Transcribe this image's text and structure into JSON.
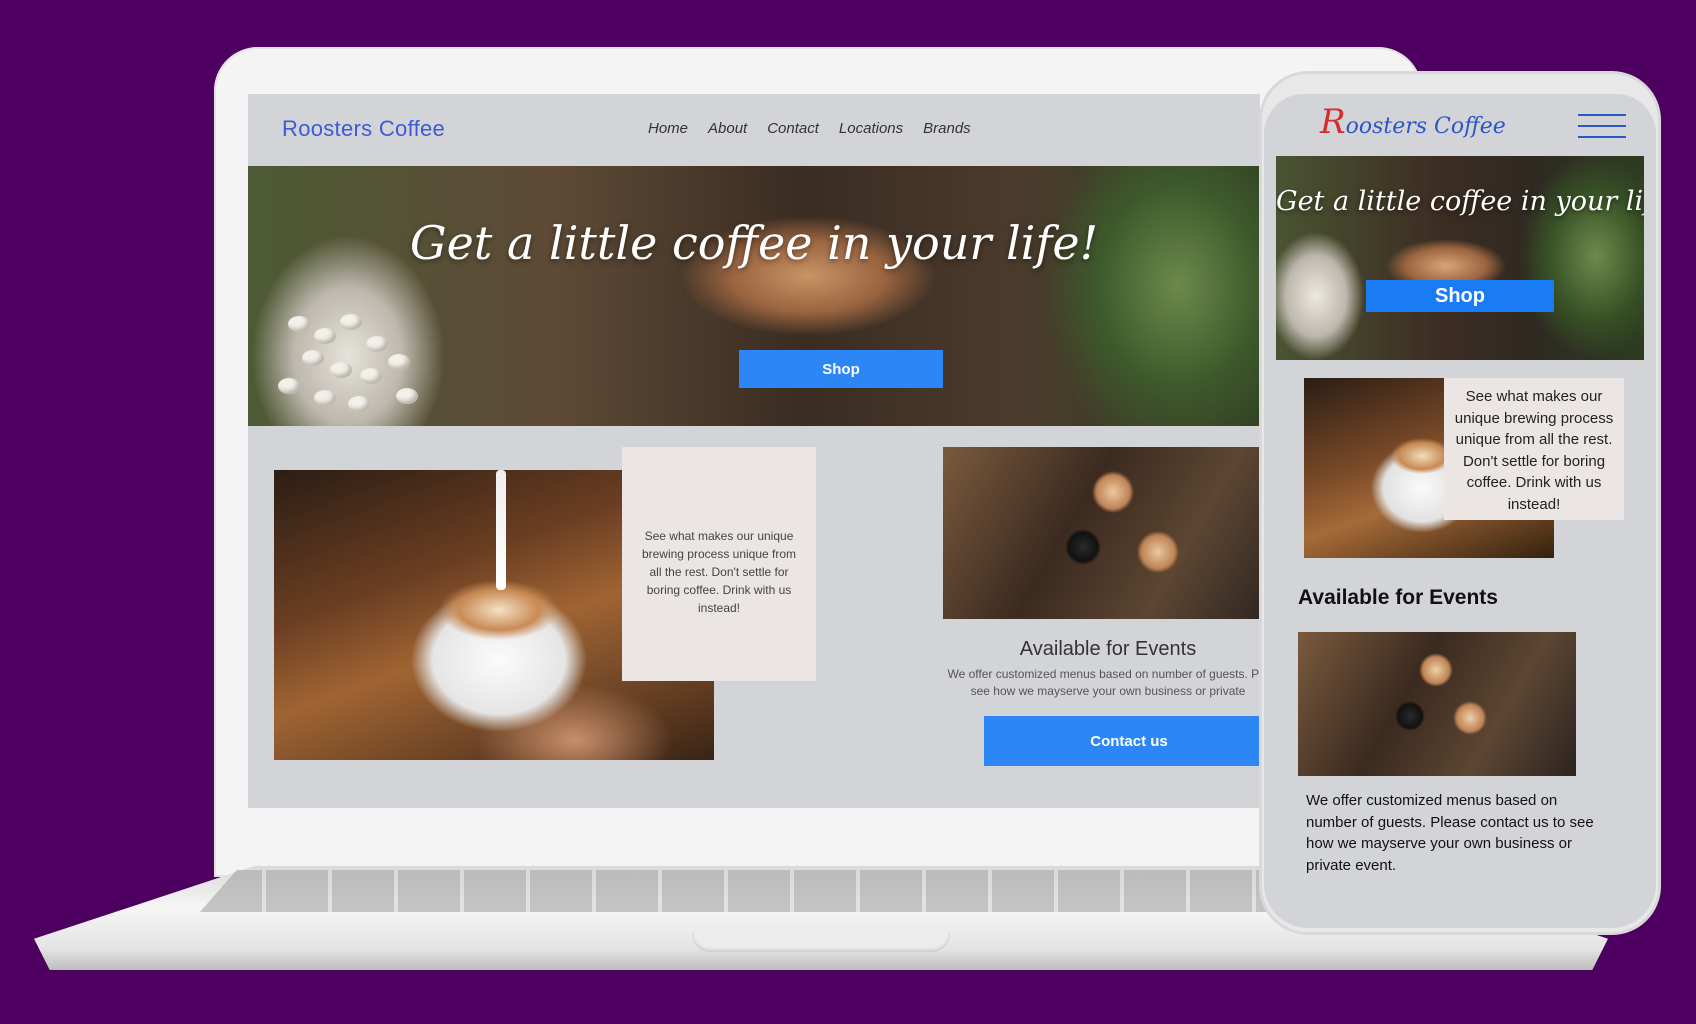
{
  "desktop": {
    "logo": "Roosters Coffee",
    "nav": [
      "Home",
      "About",
      "Contact",
      "Locations",
      "Brands"
    ],
    "hero_title": "Get a little coffee in your life!",
    "shop_label": "Shop",
    "brew_text": "See what makes our unique brewing process unique from all the rest. Don't settle for boring coffee. Drink with us instead!",
    "events_title": "Available for Events",
    "events_text_line1": "We offer customized menus based on number of guests. Ple",
    "events_text_line2": "see how we mayserve your own business or private",
    "contact_label": "Contact us"
  },
  "mobile": {
    "logo_initial": "R",
    "logo_rest": "oosters Coffee",
    "hero_title": "Get a little coffee in your life!",
    "shop_label": "Shop",
    "brew_text": "See what makes our unique brewing process unique from all the rest. Don't settle for boring coffee. Drink with us instead!",
    "events_title": "Available for Events",
    "events_text": "We offer customized menus based on number of guests. Please contact us to see how we mayserve your own business or private event."
  },
  "colors": {
    "background": "#4e0060",
    "accent": "#2c86f5",
    "logo_blue": "#3d5bd6",
    "logo_red": "#d92b2b",
    "card_bg": "#ebe6e3",
    "site_bg": "#d3d4d7"
  },
  "icons": {
    "menu": "hamburger-menu-icon"
  }
}
